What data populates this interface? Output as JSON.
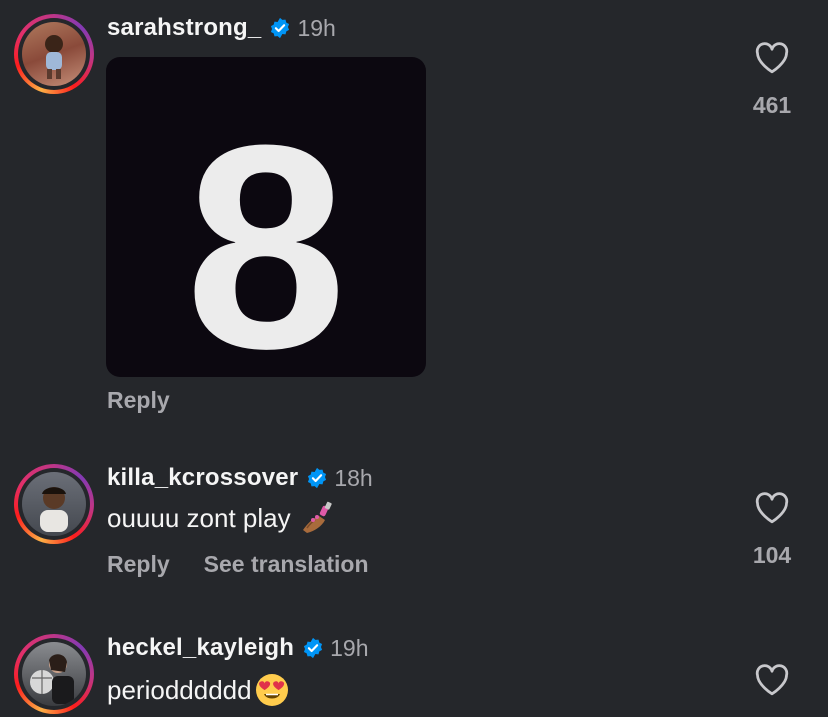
{
  "comments": [
    {
      "username": "sarahstrong_",
      "time": "19h",
      "media_text": "8",
      "reply_label": "Reply",
      "like_count": "461"
    },
    {
      "username": "killa_kcrossover",
      "time": "18h",
      "text": "ouuuu zont play",
      "emoji": "nail-polish-emoji",
      "reply_label": "Reply",
      "translate_label": "See translation",
      "like_count": "104"
    },
    {
      "username": "heckel_kayleigh",
      "time": "19h",
      "text": "periodddddd",
      "emoji": "heart-eyes-emoji"
    }
  ],
  "colors": {
    "background": "#25272b",
    "verified": "#0095f6",
    "secondary_text": "#a8a8ad"
  }
}
